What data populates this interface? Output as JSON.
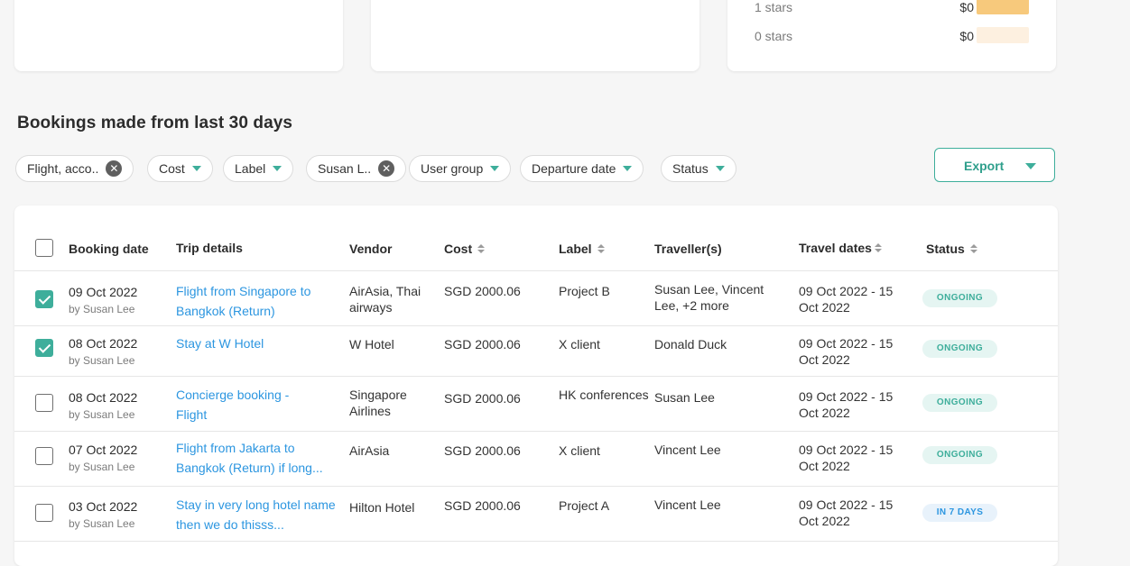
{
  "ratings": {
    "rows": [
      {
        "label": "1 stars",
        "amount": "$0",
        "color": "#f7c97c"
      },
      {
        "label": "0 stars",
        "amount": "$0",
        "color": "#fdf0e0"
      }
    ]
  },
  "section_title": "Bookings made from last 30 days",
  "filters": {
    "booking_type": "Flight, acco..",
    "cost": "Cost",
    "label": "Label",
    "user": "Susan L..",
    "user_group": "User group",
    "departure_date": "Departure date",
    "status": "Status"
  },
  "export_label": "Export",
  "table": {
    "headers": {
      "booking_date": "Booking date",
      "trip_details": "Trip details",
      "vendor": "Vendor",
      "cost": "Cost",
      "label": "Label",
      "travellers": "Traveller(s)",
      "travel_dates": "Travel dates",
      "status": "Status"
    },
    "rows": [
      {
        "checked": true,
        "date": "09 Oct 2022",
        "by": "by Susan Lee",
        "trip": "Flight from Singapore to Bangkok (Return)",
        "vendor": "AirAsia, Thai airways",
        "cost": "SGD 2000.06",
        "label": "Project B",
        "travellers": "Susan Lee, Vincent Lee, +2 more",
        "travel_dates": "09 Oct 2022 - 15 Oct 2022",
        "status": "ONGOING"
      },
      {
        "checked": true,
        "date": "08 Oct 2022",
        "by": "by Susan Lee",
        "trip": "Stay at W Hotel",
        "vendor": "W Hotel",
        "cost": "SGD 2000.06",
        "label": "X client",
        "travellers": "Donald Duck",
        "travel_dates": "09 Oct 2022 - 15 Oct 2022",
        "status": "ONGOING"
      },
      {
        "checked": false,
        "date": "08 Oct 2022",
        "by": "by Susan Lee",
        "trip": "Concierge booking - Flight",
        "vendor": "Singapore Airlines",
        "cost": "SGD 2000.06",
        "label": "HK conferences",
        "travellers": "Susan Lee",
        "travel_dates": "09 Oct 2022 - 15 Oct 2022",
        "status": "ONGOING"
      },
      {
        "checked": false,
        "date": "07 Oct 2022",
        "by": "by Susan Lee",
        "trip": "Flight from Jakarta to Bangkok (Return) if long...",
        "vendor": "AirAsia",
        "cost": "SGD 2000.06",
        "label": "X client",
        "travellers": "Vincent Lee",
        "travel_dates": "09 Oct 2022 - 15 Oct 2022",
        "status": "ONGOING"
      },
      {
        "checked": false,
        "date": "03 Oct 2022",
        "by": "by Susan Lee",
        "trip": "Stay in very long hotel name then we do thisss...",
        "vendor": "Hilton Hotel",
        "cost": "SGD 2000.06",
        "label": "Project A",
        "travellers": "Vincent Lee",
        "travel_dates": "09 Oct 2022 - 15 Oct 2022",
        "status": "IN 7 DAYS"
      }
    ]
  }
}
